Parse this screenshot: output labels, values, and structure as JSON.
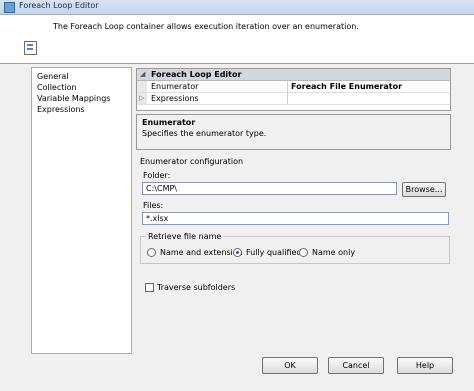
{
  "window": {
    "title": "Foreach Loop Editor"
  },
  "header": {
    "description": "The Foreach Loop container allows execution iteration over an enumeration."
  },
  "sidebar": {
    "items": [
      {
        "label": "General"
      },
      {
        "label": "Collection"
      },
      {
        "label": "Variable Mappings"
      },
      {
        "label": "Expressions"
      }
    ]
  },
  "property_grid": {
    "category": "Foreach Loop Editor",
    "rows": [
      {
        "name": "Enumerator",
        "value": "Foreach File Enumerator"
      },
      {
        "name": "Expressions",
        "value": ""
      }
    ]
  },
  "description_box": {
    "title": "Enumerator",
    "text": "Specifies the enumerator type."
  },
  "enumerator_config": {
    "section_label": "Enumerator configuration",
    "folder_label": "Folder:",
    "folder_value": "C:\\CMP\\",
    "browse_label": "Browse...",
    "files_label": "Files:",
    "files_value": "*.xlsx",
    "retrieve_label": "Retrieve file name",
    "options": [
      {
        "label": "Name and extension",
        "selected": false
      },
      {
        "label": "Fully qualified",
        "selected": true
      },
      {
        "label": "Name only",
        "selected": false
      }
    ],
    "traverse_label": "Traverse subfolders",
    "traverse_checked": false
  },
  "buttons": {
    "ok": "OK",
    "cancel": "Cancel",
    "help": "Help"
  }
}
